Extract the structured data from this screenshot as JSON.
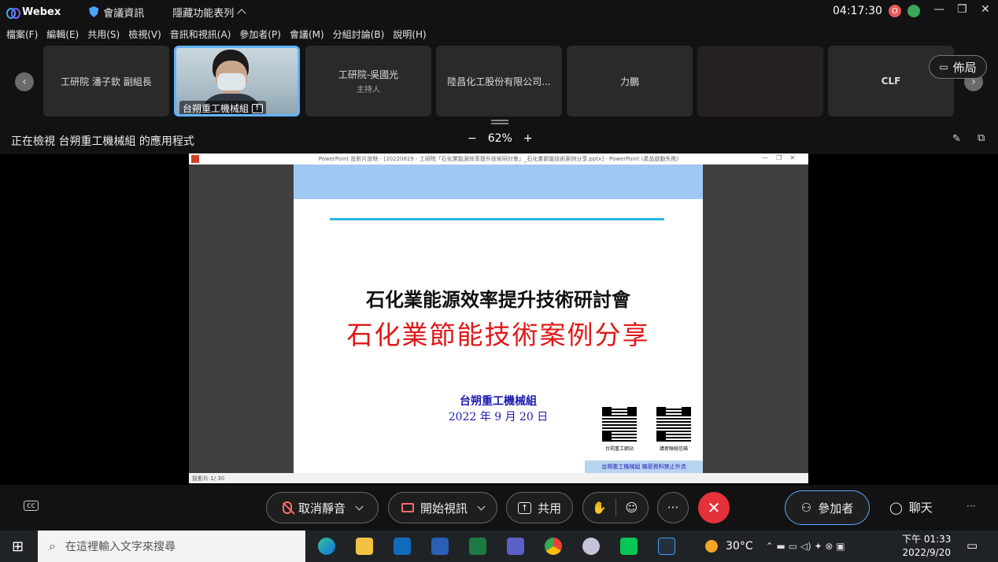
{
  "app": {
    "name": "Webex",
    "meeting_info": "會議資訊",
    "hide_menu": "隱藏功能表列",
    "timer": "04:17:30",
    "rec_badge": "O"
  },
  "menu": [
    "檔案(F)",
    "編輯(E)",
    "共用(S)",
    "檢視(V)",
    "音訊和視訊(A)",
    "參加者(P)",
    "會議(M)",
    "分組討論(B)",
    "說明(H)"
  ],
  "participants": [
    {
      "name": "工研院 潘子欽 副組長",
      "sub": ""
    },
    {
      "name": "台朔重工機械組",
      "sub": "",
      "active": true
    },
    {
      "name": "工研院-吳國光",
      "sub": "主持人"
    },
    {
      "name": "陸昌化工股份有限公司...",
      "sub": ""
    },
    {
      "name": "力鵬",
      "sub": ""
    },
    {
      "name": "",
      "sub": ""
    },
    {
      "name": "CLF",
      "sub": ""
    }
  ],
  "layout_label": "佈局",
  "viewing": "正在檢視 台朔重工機械組 的應用程式",
  "zoom": {
    "minus": "−",
    "value": "62%",
    "plus": "+"
  },
  "ppt": {
    "window_title": "PowerPoint 投影片放映 - [20220829 - 工研院「石化業能源效率提升技術研討會」_石化業節能技術案例分享.pptx] - PowerPoint (產品啟動失敗)",
    "status": "投影片 1/ 30"
  },
  "slide": {
    "title1": "石化業能源效率提升技術研討會",
    "title2": "石化業節能技術案例分享",
    "org": "台朔重工機械組",
    "date": "2022 年 9 月 20 日",
    "qr1_label": "台朔重工網站",
    "qr2_label": "講者聯絡信箱",
    "footer": "台朔重工機械組 機密資料禁止外流"
  },
  "controls": {
    "unmute": "取消靜音",
    "start_video": "開始視訊",
    "share": "共用",
    "more": "···",
    "participants": "參加者",
    "chat": "聊天"
  },
  "taskbar": {
    "search_placeholder": "在這裡輸入文字來搜尋",
    "temperature": "30°C",
    "time": "下午 01:33",
    "date": "2022/9/20"
  }
}
